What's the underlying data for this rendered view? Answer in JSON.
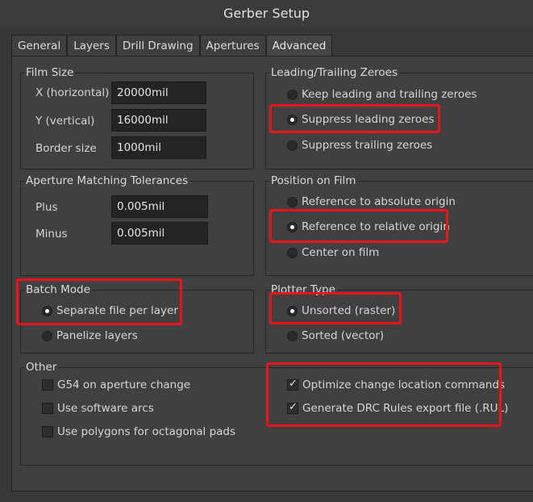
{
  "window": {
    "title": "Gerber Setup"
  },
  "tabs": [
    "General",
    "Layers",
    "Drill Drawing",
    "Apertures",
    "Advanced"
  ],
  "film_size": {
    "title": "Film Size",
    "x_label": "X (horizontal)",
    "x_value": "20000mil",
    "y_label": "Y (vertical)",
    "y_value": "16000mil",
    "border_label": "Border size",
    "border_value": "1000mil"
  },
  "leading_trailing": {
    "title": "Leading/Trailing Zeroes",
    "options": [
      "Keep leading and trailing zeroes",
      "Suppress leading zeroes",
      "Suppress trailing zeroes"
    ],
    "selected": "Suppress leading zeroes"
  },
  "aperture_tolerances": {
    "title": "Aperture Matching Tolerances",
    "plus_label": "Plus",
    "plus_value": "0.005mil",
    "minus_label": "Minus",
    "minus_value": "0.005mil"
  },
  "position_on_film": {
    "title": "Position on Film",
    "options": [
      "Reference to absolute origin",
      "Reference to relative origin",
      "Center on film"
    ],
    "selected": "Reference to relative origin"
  },
  "batch_mode": {
    "title": "Batch Mode",
    "options": [
      "Separate file per layer",
      "Panelize layers"
    ],
    "selected": "Separate file per layer"
  },
  "plotter_type": {
    "title": "Plotter Type",
    "options": [
      "Unsorted (raster)",
      "Sorted (vector)"
    ],
    "selected": "Unsorted (raster)"
  },
  "other": {
    "title": "Other",
    "left_options": [
      {
        "label": "G54 on aperture change",
        "checked": false
      },
      {
        "label": "Use software arcs",
        "checked": false
      },
      {
        "label": "Use polygons for octagonal pads",
        "checked": false
      }
    ],
    "right_options": [
      {
        "label": "Optimize change location commands",
        "checked": true
      },
      {
        "label": "Generate DRC Rules export file (.RUL)",
        "checked": true
      }
    ]
  },
  "colors": {
    "highlight": "#e8141c",
    "background": "#404040"
  }
}
